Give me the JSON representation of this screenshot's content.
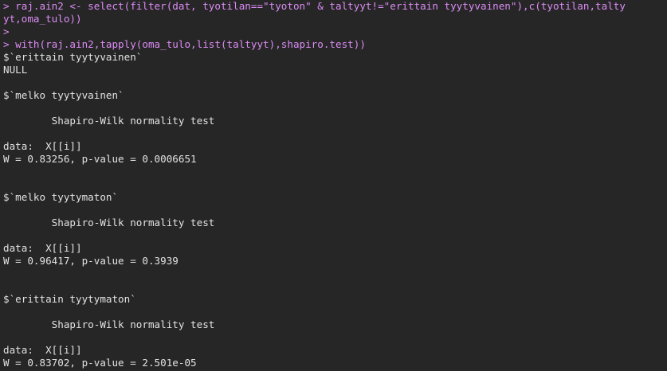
{
  "console": {
    "lines": [
      {
        "kind": "cmd",
        "text": "> raj.ain2 <- select(filter(dat, tyotilan==\"tyoton\" & taltyyt!=\"erittain tyytyvainen\"),c(tyotilan,talty"
      },
      {
        "kind": "cmd",
        "text": "yt,oma_tulo))"
      },
      {
        "kind": "cmd",
        "text": ">"
      },
      {
        "kind": "cmd",
        "text": "> with(raj.ain2,tapply(oma_tulo,list(taltyyt),shapiro.test))"
      },
      {
        "kind": "out",
        "text": "$`erittain tyytyvainen`"
      },
      {
        "kind": "out",
        "text": "NULL"
      },
      {
        "kind": "out",
        "text": ""
      },
      {
        "kind": "out",
        "text": "$`melko tyytyvainen`"
      },
      {
        "kind": "out",
        "text": ""
      },
      {
        "kind": "out",
        "text": "\tShapiro-Wilk normality test"
      },
      {
        "kind": "out",
        "text": ""
      },
      {
        "kind": "out",
        "text": "data:  X[[i]]"
      },
      {
        "kind": "out",
        "text": "W = 0.83256, p-value = 0.0006651"
      },
      {
        "kind": "out",
        "text": ""
      },
      {
        "kind": "out",
        "text": ""
      },
      {
        "kind": "out",
        "text": "$`melko tyytymaton`"
      },
      {
        "kind": "out",
        "text": ""
      },
      {
        "kind": "out",
        "text": "\tShapiro-Wilk normality test"
      },
      {
        "kind": "out",
        "text": ""
      },
      {
        "kind": "out",
        "text": "data:  X[[i]]"
      },
      {
        "kind": "out",
        "text": "W = 0.96417, p-value = 0.3939"
      },
      {
        "kind": "out",
        "text": ""
      },
      {
        "kind": "out",
        "text": ""
      },
      {
        "kind": "out",
        "text": "$`erittain tyytymaton`"
      },
      {
        "kind": "out",
        "text": ""
      },
      {
        "kind": "out",
        "text": "\tShapiro-Wilk normality test"
      },
      {
        "kind": "out",
        "text": ""
      },
      {
        "kind": "out",
        "text": "data:  X[[i]]"
      },
      {
        "kind": "out",
        "text": "W = 0.83702, p-value = 2.501e-05"
      }
    ]
  },
  "colors": {
    "background": "#262626",
    "command_text": "#dc8cf5",
    "output_text": "#e2e2e2"
  }
}
